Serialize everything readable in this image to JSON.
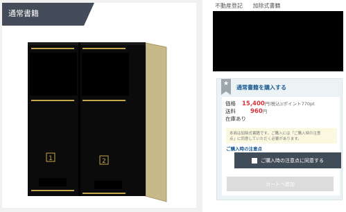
{
  "category_tab": {
    "label": "通常書籍"
  },
  "breadcrumb": {
    "items": [
      "不動産登記",
      "加除式書籍"
    ]
  },
  "product_image": {
    "door_labels": [
      "1",
      "2"
    ],
    "accent_color": "#c7a64a",
    "side_color": "#c6b98a"
  },
  "purchase": {
    "header_icon": "star-icon",
    "title": "通常書籍を購入する",
    "price_label": "価格",
    "price_value": "15,400",
    "price_suffix": "円(税込)/ポイント770pt",
    "shipping_label": "送料",
    "shipping_value": "960",
    "shipping_suffix": "円",
    "stock": "在庫あり",
    "notice_line1": "本商は加除式書籍です。ご購入には「ご購入時の注意",
    "notice_line2": "点」に同意していただく必要があります。",
    "notice_link": "ご購入時の注意点",
    "agree_button": "ご購入時の注意点に同意する",
    "cart_button": "カートへ追加",
    "accent_color": "#1a5a94",
    "price_color": "#d6343a"
  }
}
